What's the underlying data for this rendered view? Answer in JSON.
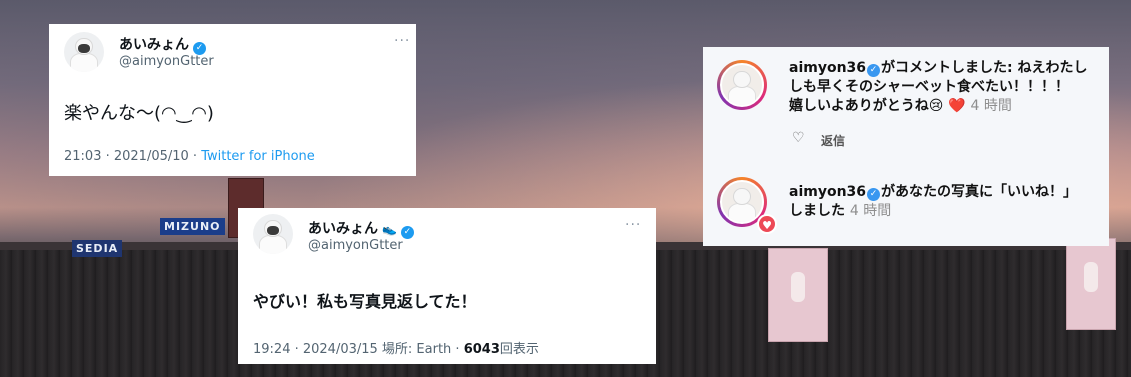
{
  "tweet1": {
    "name": "あいみょん",
    "handle": "@aimyonGtter",
    "text": "楽やんな〜(◠‿◠)",
    "time": "21:03 · 2021/05/10 · ",
    "source": "Twitter for iPhone"
  },
  "tweet2": {
    "name": "あいみょん",
    "handle": "@aimyonGtter",
    "text": "やびい！私も写真見返してた！",
    "meta_prefix": "19:24 · 2024/03/15 場所: Earth · ",
    "views_count": "6043",
    "views_label": "回表示"
  },
  "instagram": {
    "notif1": {
      "user": "aimyon36",
      "text_line1": "がコメントしました: ねえわたし",
      "text_line2": "しも早くそのシャーベット食べたい！！！！",
      "text_line3": "嬉しいよありがとうね",
      "emojis": "😢 ❤️",
      "time": "4 時間",
      "reply_label": "返信"
    },
    "notif2": {
      "user": "aimyon36",
      "text_line1": "があなたの写真に「いいね！」",
      "text_line2": "しました",
      "time": "4 時間"
    }
  },
  "background": {
    "signs": [
      "SEDIA",
      "MIZUNO"
    ],
    "colors": {
      "twitter_blue": "#1d9bf0",
      "ig_like_red": "#ed4956"
    }
  }
}
